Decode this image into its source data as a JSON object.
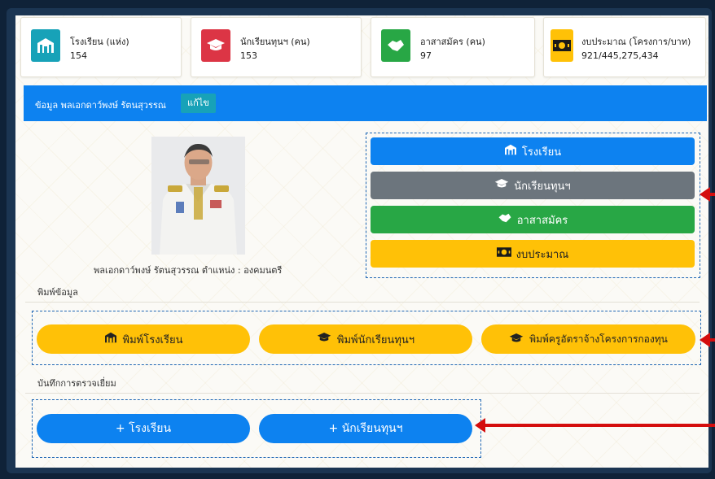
{
  "stats": [
    {
      "label": "โรงเรียน (แห่ง)",
      "value": "154",
      "icon": "school-icon",
      "color": "#17a2b8"
    },
    {
      "label": "นักเรียนทุนฯ (คน)",
      "value": "153",
      "icon": "graduation-cap-icon",
      "color": "#dc3545"
    },
    {
      "label": "อาสาสมัคร (คน)",
      "value": "97",
      "icon": "handshake-icon",
      "color": "#28a745"
    },
    {
      "label": "งบประมาณ (โครงการ/บาท)",
      "value": "921/445,275,434",
      "icon": "money-icon",
      "color": "#ffc107"
    }
  ],
  "header": {
    "title": "ข้อมูล พลเอกดาว์พงษ์ รัตนสุวรรณ",
    "edit": "แก้ไข"
  },
  "person": {
    "caption": "พลเอกดาว์พงษ์ รัตนสุวรรณ   ตำแหน่ง : องคมนตรี"
  },
  "menu": {
    "school": "โรงเรียน",
    "students": "นักเรียนทุนฯ",
    "volunteers": "อาสาสมัคร",
    "budget": "งบประมาณ"
  },
  "print": {
    "section": "พิมพ์ข้อมูล",
    "school": "พิมพ์โรงเรียน",
    "students": "พิมพ์นักเรียนทุนฯ",
    "teachers": "พิมพ์ครูอัตราจ้างโครงการกองทุน"
  },
  "visit": {
    "section": "บันทึกการตรวจเยี่ยม",
    "school": "+ โรงเรียน",
    "students": "+ นักเรียนทุนฯ"
  }
}
